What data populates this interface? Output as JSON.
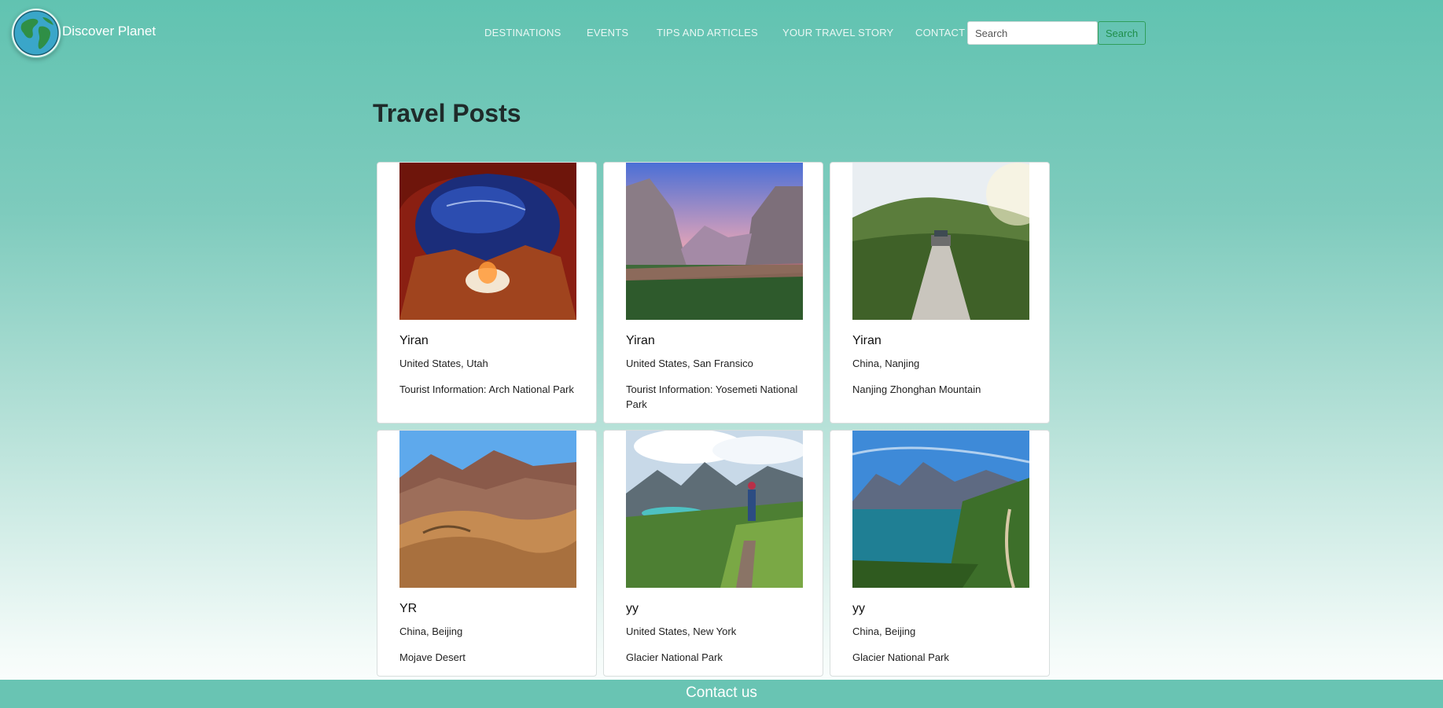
{
  "header": {
    "brand": "Discover Planet",
    "logo_icon": "globe-icon",
    "nav": [
      {
        "label": "DESTINATIONS"
      },
      {
        "label": "EVENTS"
      },
      {
        "label": "TIPS AND ARTICLES"
      },
      {
        "label": "YOUR TRAVEL STORY"
      },
      {
        "label": "CONTACT"
      }
    ],
    "search_placeholder": "Search",
    "search_button": "Search"
  },
  "main": {
    "title": "Travel Posts",
    "posts": [
      {
        "author": "Yiran",
        "location": "United States, Utah",
        "info": "Tourist Information: Arch National Park"
      },
      {
        "author": "Yiran",
        "location": "United States, San Fransico",
        "info": "Tourist Information: Yosemeti National Park"
      },
      {
        "author": "Yiran",
        "location": "China, Nanjing",
        "info": "Nanjing Zhonghan Mountain"
      },
      {
        "author": "YR",
        "location": "China, Beijing",
        "info": "Mojave Desert"
      },
      {
        "author": "yy",
        "location": "United States, New York",
        "info": "Glacier National Park"
      },
      {
        "author": "yy",
        "location": "China, Beijing",
        "info": "Glacier National Park"
      }
    ]
  },
  "footer": {
    "contact": "Contact us"
  },
  "colors": {
    "accent": "#61c3b1",
    "search_button": "#2f9e5b",
    "footer": "#69c4b3"
  }
}
